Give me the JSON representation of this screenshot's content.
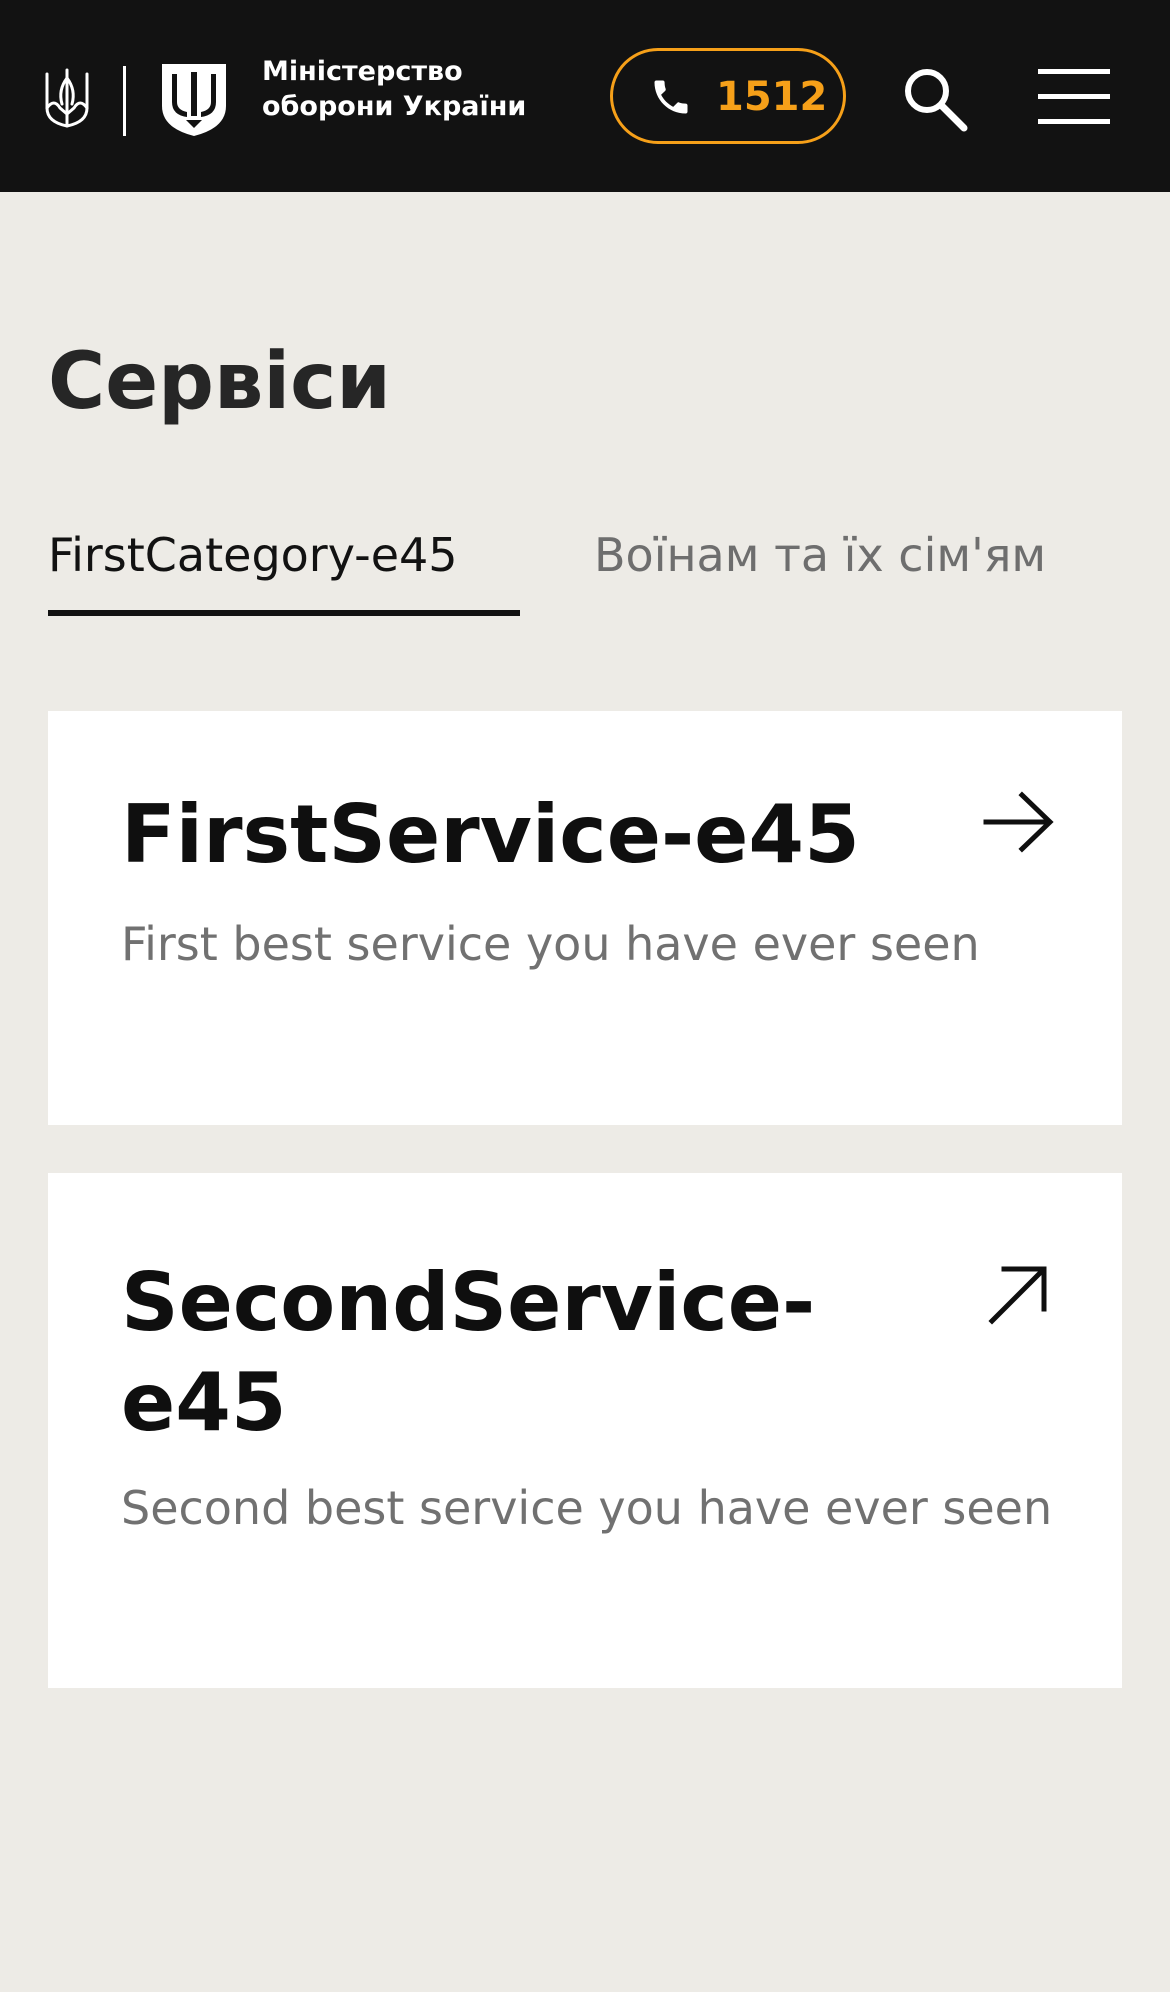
{
  "header": {
    "org_name_line1": "Міністерство",
    "org_name_line2": "оборони України",
    "hotline": "1512",
    "colors": {
      "background": "#121212",
      "accent": "#f6a019",
      "text": "#ffffff"
    },
    "icons": [
      "trident-icon",
      "mod-shield-icon",
      "phone-icon",
      "search-icon",
      "hamburger-menu-icon"
    ]
  },
  "page": {
    "title": "Сервіси",
    "background": "#edebe6"
  },
  "tabs": [
    {
      "label": "FirstCategory-e45",
      "active": true
    },
    {
      "label": "Воїнам та їх сім'ям",
      "active": false
    }
  ],
  "services": [
    {
      "title": "FirstService-e45",
      "description": "First best service you have ever seen",
      "icon": "arrow-right-icon"
    },
    {
      "title": "SecondService-e45",
      "description": "Second best service you have ever seen",
      "icon": "arrow-up-right-external-icon"
    }
  ]
}
